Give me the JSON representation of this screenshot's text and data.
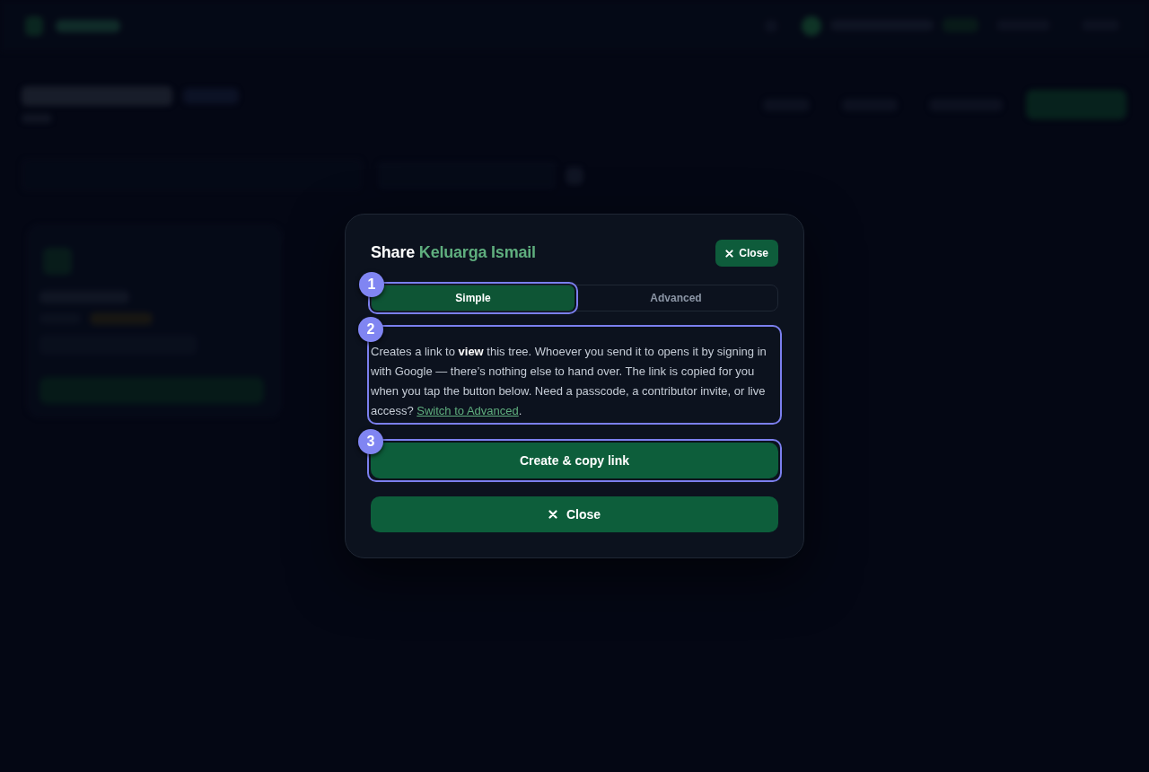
{
  "dialog": {
    "title": "Share",
    "tree_name": "Keluarga Ismail",
    "close_button": {
      "label": "Close"
    },
    "tabs": [
      {
        "label": "Simple",
        "selected": true,
        "callout": "1"
      },
      {
        "label": "Advanced",
        "selected": false
      }
    ],
    "description": {
      "text": "Creates a link to **view** this tree. Whoever you send it to opens it by signing in with Google — there’s nothing else to hand over. The link is copied for you when you tap the button below. Need a passcode, a contributor invite, or live access?",
      "link": "Switch to Advanced",
      "end": ".",
      "callout": "2"
    },
    "actions": [
      {
        "kind": "primary",
        "label": "Create & copy link",
        "callout": "3"
      },
      {
        "kind": "close",
        "label": "Close"
      }
    ]
  }
}
